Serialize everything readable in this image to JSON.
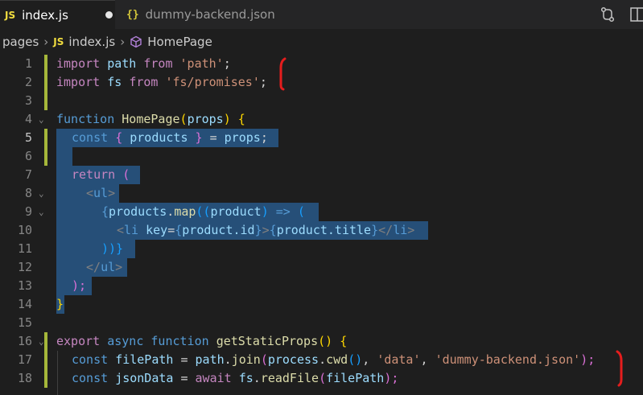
{
  "tabs": [
    {
      "icon": "JS",
      "label": "index.js",
      "active": true,
      "modified": true
    },
    {
      "icon": "{}",
      "label": "dummy-backend.json",
      "active": false,
      "modified": false
    }
  ],
  "breadcrumb": {
    "folder": "pages",
    "file_icon": "JS",
    "file": "index.js",
    "symbol": "HomePage"
  },
  "line_numbers": [
    "1",
    "2",
    "3",
    "4",
    "5",
    "6",
    "7",
    "8",
    "9",
    "10",
    "11",
    "12",
    "13",
    "14",
    "15",
    "16",
    "17",
    "18"
  ],
  "code": {
    "l1": {
      "kw": "import",
      "a": "path",
      "from": "from",
      "str": "'path'",
      "end": ";"
    },
    "l2": {
      "kw": "import",
      "a": "fs",
      "from": "from",
      "str": "'fs/promises'",
      "end": ";"
    },
    "l4": {
      "kw": "function",
      "name": "HomePage",
      "open": "(",
      "param": "props",
      "close": ")",
      "brace": "{"
    },
    "l5": {
      "kw": "const",
      "open": "{",
      "var": "products",
      "close": "}",
      "eq": "=",
      "rhs": "props",
      "end": ";"
    },
    "l7": {
      "kw": "return",
      "paren": "("
    },
    "l8": {
      "lt": "<",
      "tag": "ul",
      "gt": ">"
    },
    "l9": {
      "open": "{",
      "obj": "products",
      "dot": ".",
      "method": "map",
      "p1": "((",
      "param": "product",
      "p2": ")",
      "arrow": "=>",
      "p3": "("
    },
    "l10": {
      "lt": "<",
      "tag": "li",
      "attr": "key",
      "eq": "=",
      "o1": "{",
      "expr1": "product.id",
      "c1": "}",
      "gt": ">",
      "o2": "{",
      "expr2": "product.title",
      "c2": "}",
      "close": "</",
      "ctag": "li",
      "cgt": ">"
    },
    "l11": {
      "text": "))}"
    },
    "l12": {
      "lt": "</",
      "tag": "ul",
      "gt": ">"
    },
    "l13": {
      "text": ");"
    },
    "l14": {
      "text": "}"
    },
    "l16": {
      "export": "export",
      "async": "async",
      "fn": "function",
      "name": "getStaticProps",
      "parens": "()",
      "brace": "{"
    },
    "l17": {
      "kw": "const",
      "var": "filePath",
      "eq": "=",
      "obj": "path",
      "dot": ".",
      "method": "join",
      "open": "(",
      "obj2": "process",
      "dot2": ".",
      "method2": "cwd",
      "call": "()",
      "comma": ",",
      "s1": "'data'",
      "comma2": ",",
      "s2": "'dummy-backend.json'",
      "close": ");"
    },
    "l18": {
      "kw": "const",
      "var": "jsonData",
      "eq": "=",
      "await": "await",
      "obj": "fs",
      "dot": ".",
      "method": "readFile",
      "open": "(",
      "arg": "filePath",
      "close": ");"
    }
  },
  "colors": {
    "background": "#1e1e1e",
    "selection": "#264f78",
    "modified_gutter": "#a5b73a",
    "annotation": "#e51d1d"
  },
  "icons": [
    "source-control-icon",
    "split-editor-icon",
    "symbol-method-icon",
    "fold-chevron-icon"
  ]
}
